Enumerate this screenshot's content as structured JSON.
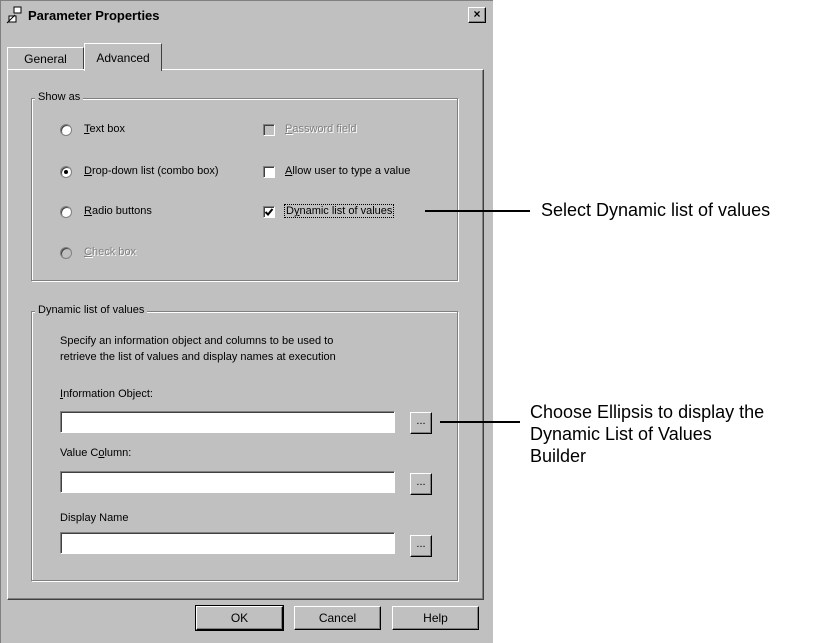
{
  "window": {
    "title": "Parameter Properties",
    "close_glyph": "×"
  },
  "tabs": [
    {
      "label": "General"
    },
    {
      "label": "Advanced"
    }
  ],
  "show_as": {
    "legend": "Show as",
    "options": {
      "text_box": "Text box",
      "dropdown": "Drop-down list (combo box)",
      "radio_buttons": "Radio buttons",
      "check_box": "Check box"
    },
    "selected": "dropdown",
    "checkboxes": {
      "password_field": "Password field",
      "allow_type": "Allow user to type a value",
      "dynamic_list": "Dynamic list of values"
    },
    "dynamic_list_checked": true
  },
  "dynamic": {
    "legend": "Dynamic list of values",
    "description_line1": "Specify an information object and columns to be used to",
    "description_line2": "retrieve the list of values and display names at execution",
    "info_object_label": "Information Object:",
    "value_column_label": "Value Column:",
    "display_name_label": "Display Name",
    "info_object_value": "",
    "value_column_value": "",
    "display_name_value": "",
    "ellipsis": "..."
  },
  "buttons": {
    "ok": "OK",
    "cancel": "Cancel",
    "help": "Help"
  },
  "callouts": {
    "dynamic_list": "Select Dynamic list of values",
    "ellipsis_line1": "Choose Ellipsis to display the",
    "ellipsis_line2": "Dynamic List of Values",
    "ellipsis_line3": "Builder"
  }
}
